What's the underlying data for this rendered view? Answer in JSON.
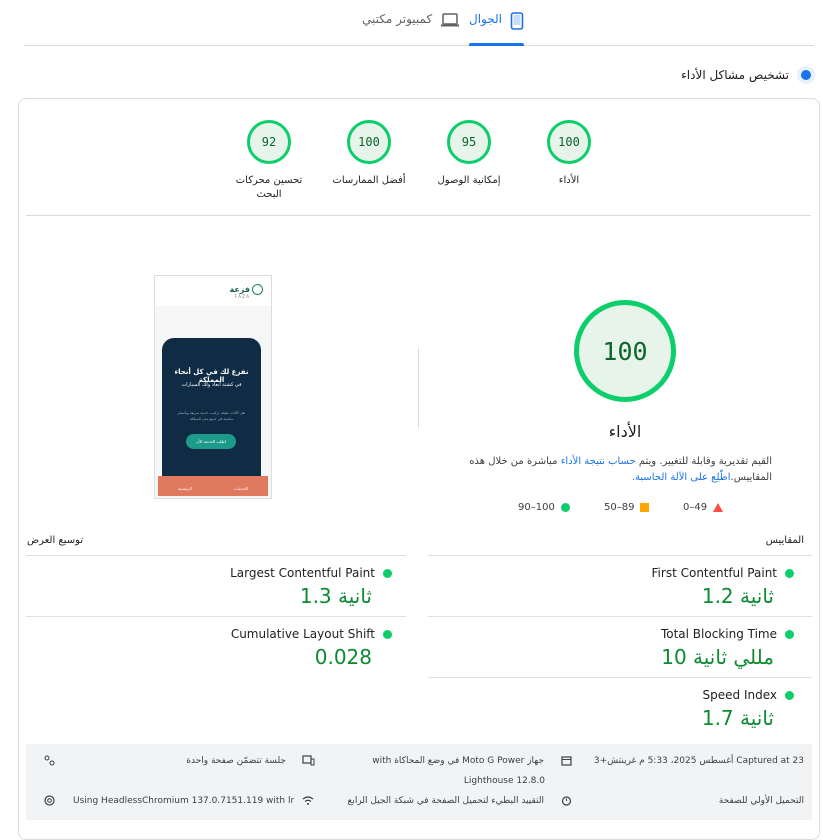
{
  "tabs": {
    "mobile": "الجوال",
    "desktop": "كمبيوتر مكتبي"
  },
  "diagnose_label": "تشخيص مشاكل الأداء",
  "categories": [
    {
      "score": "100",
      "label": "الأداء"
    },
    {
      "score": "95",
      "label": "إمكانية الوصول"
    },
    {
      "score": "100",
      "label": "أفضل الممارسات"
    },
    {
      "score": "92",
      "label": "تحسين محركات البحث"
    }
  ],
  "performance": {
    "score": "100",
    "title": "الأداء",
    "desc_before": "القيم تقديرية وقابلة للتغيير. ويتم ",
    "desc_link": "حساب نتيجة الأداء",
    "desc_after": " مباشرة من خلال هذه المقاييس.",
    "calc_link": "اطّلِع على الآلة الحاسبة."
  },
  "legend": {
    "bad": "0–49",
    "average": "50–89",
    "good": "90–100"
  },
  "metrics_header": "المقاييس",
  "expand_view": "توسيع العرض",
  "metrics": {
    "fcp": {
      "name": "First Contentful Paint",
      "value": "1.2 ثانية"
    },
    "lcp": {
      "name": "Largest Contentful Paint",
      "value": "1.3 ثانية"
    },
    "tbt": {
      "name": "Total Blocking Time",
      "value": "10 مللي ثانية"
    },
    "cls": {
      "name": "Cumulative Layout Shift",
      "value": "0.028"
    },
    "si": {
      "name": "Speed Index",
      "value": "1.7 ثانية"
    }
  },
  "footer": {
    "captured": "Captured at 23 أغسطس 2025، 5:33 م غرينتش+3",
    "device": "جهاز Moto G Power في وضع المحاكاة with",
    "lighthouse": "Lighthouse 12.8.0",
    "session": "جلسة تتضمّن صفحة واحدة",
    "initial_load": "التحميل الأولي للصفحة",
    "throttling": "التقييد البطيء لتحميل الصفحة في شبكة الجيل الرابع",
    "browser": "Using HeadlessChromium 137.0.7151.119 with lr"
  },
  "preview": {
    "logo": "فزعة",
    "logo_sub": "F A Z A",
    "headline1": "نفزع لك في كل أنحاء المملكة",
    "headline2": "في كشتة أبعاد ولك السيارات",
    "body": "نقل الأثاث، تعبئة، تركيب، خدمة سريعة وبأسعار مناسبة في جميع مدن المملكة",
    "cta": "اطلب الخدمة الآن",
    "nav1": "الرئيسية",
    "nav2": "الخدمات"
  },
  "colors": {
    "good": "#0cce6b",
    "average": "#ffa400",
    "bad": "#ff4e42",
    "accent": "#1a73e8"
  }
}
